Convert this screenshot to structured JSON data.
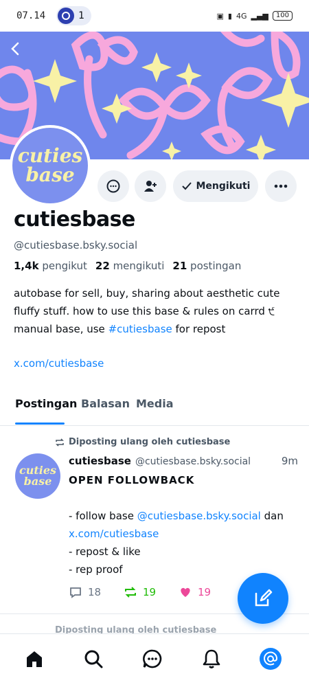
{
  "status_bar": {
    "time": "07.14",
    "notification_count": "1",
    "network": "4G",
    "battery": "100"
  },
  "profile": {
    "avatar_text_line1": "cuties",
    "avatar_text_line2": "base",
    "name": "cutiesbase",
    "handle": "@cutiesbase.bsky.social",
    "followers_count": "1,4k",
    "followers_label": "pengikut",
    "following_count": "22",
    "following_label": "mengikuti",
    "posts_count": "21",
    "posts_label": "postingan",
    "bio_line1": "autobase for sell, buy, sharing about aesthetic cute fluffy stuff. how to use this base & rules on carrd ੯",
    "bio_line2_pre": "manual base, use ",
    "bio_hashtag": "#cutiesbase",
    "bio_line2_post": " for repost",
    "link": "x.com/cutiesbase",
    "follow_button_label": "Mengikuti"
  },
  "tabs": [
    {
      "label": "Postingan",
      "active": true
    },
    {
      "label": "Balasan",
      "active": false
    },
    {
      "label": "Media",
      "active": false
    }
  ],
  "post": {
    "repost_label": "Diposting ulang oleh cutiesbase",
    "author": "cutiesbase",
    "handle": "@cutiesbase.bsky.social",
    "time": "9m",
    "line1": "OPEN FOLLOWBACK",
    "line2_pre": "- follow base ",
    "line2_mention": "@cutiesbase.bsky.social",
    "line2_post": " dan",
    "line3_link": "x.com/cutiesbase",
    "line4": "- repost & like",
    "line5": "- rep proof",
    "reply_count": "18",
    "repost_count": "19",
    "like_count": "19"
  },
  "next_post": {
    "repost_label": "Diposting ulang oleh cutiesbase"
  },
  "icons": {
    "back": "chevron-left-icon",
    "message": "chat-bubble-icon",
    "add_user": "person-plus-icon",
    "check": "check-icon",
    "more": "ellipsis-icon",
    "repost": "repost-icon",
    "reply": "reply-icon",
    "like": "heart-icon",
    "compose": "compose-icon",
    "home": "home-icon",
    "search": "search-icon",
    "chat": "chat-icon",
    "notifications": "bell-icon",
    "profile": "at-sign-icon"
  },
  "colors": {
    "accent": "#1083fe",
    "banner": "#6f86ec",
    "ribbon": "#f7a8dc",
    "sparkle": "#f8f1a6",
    "repost_green": "#20bc07",
    "like_pink": "#ec4899"
  }
}
